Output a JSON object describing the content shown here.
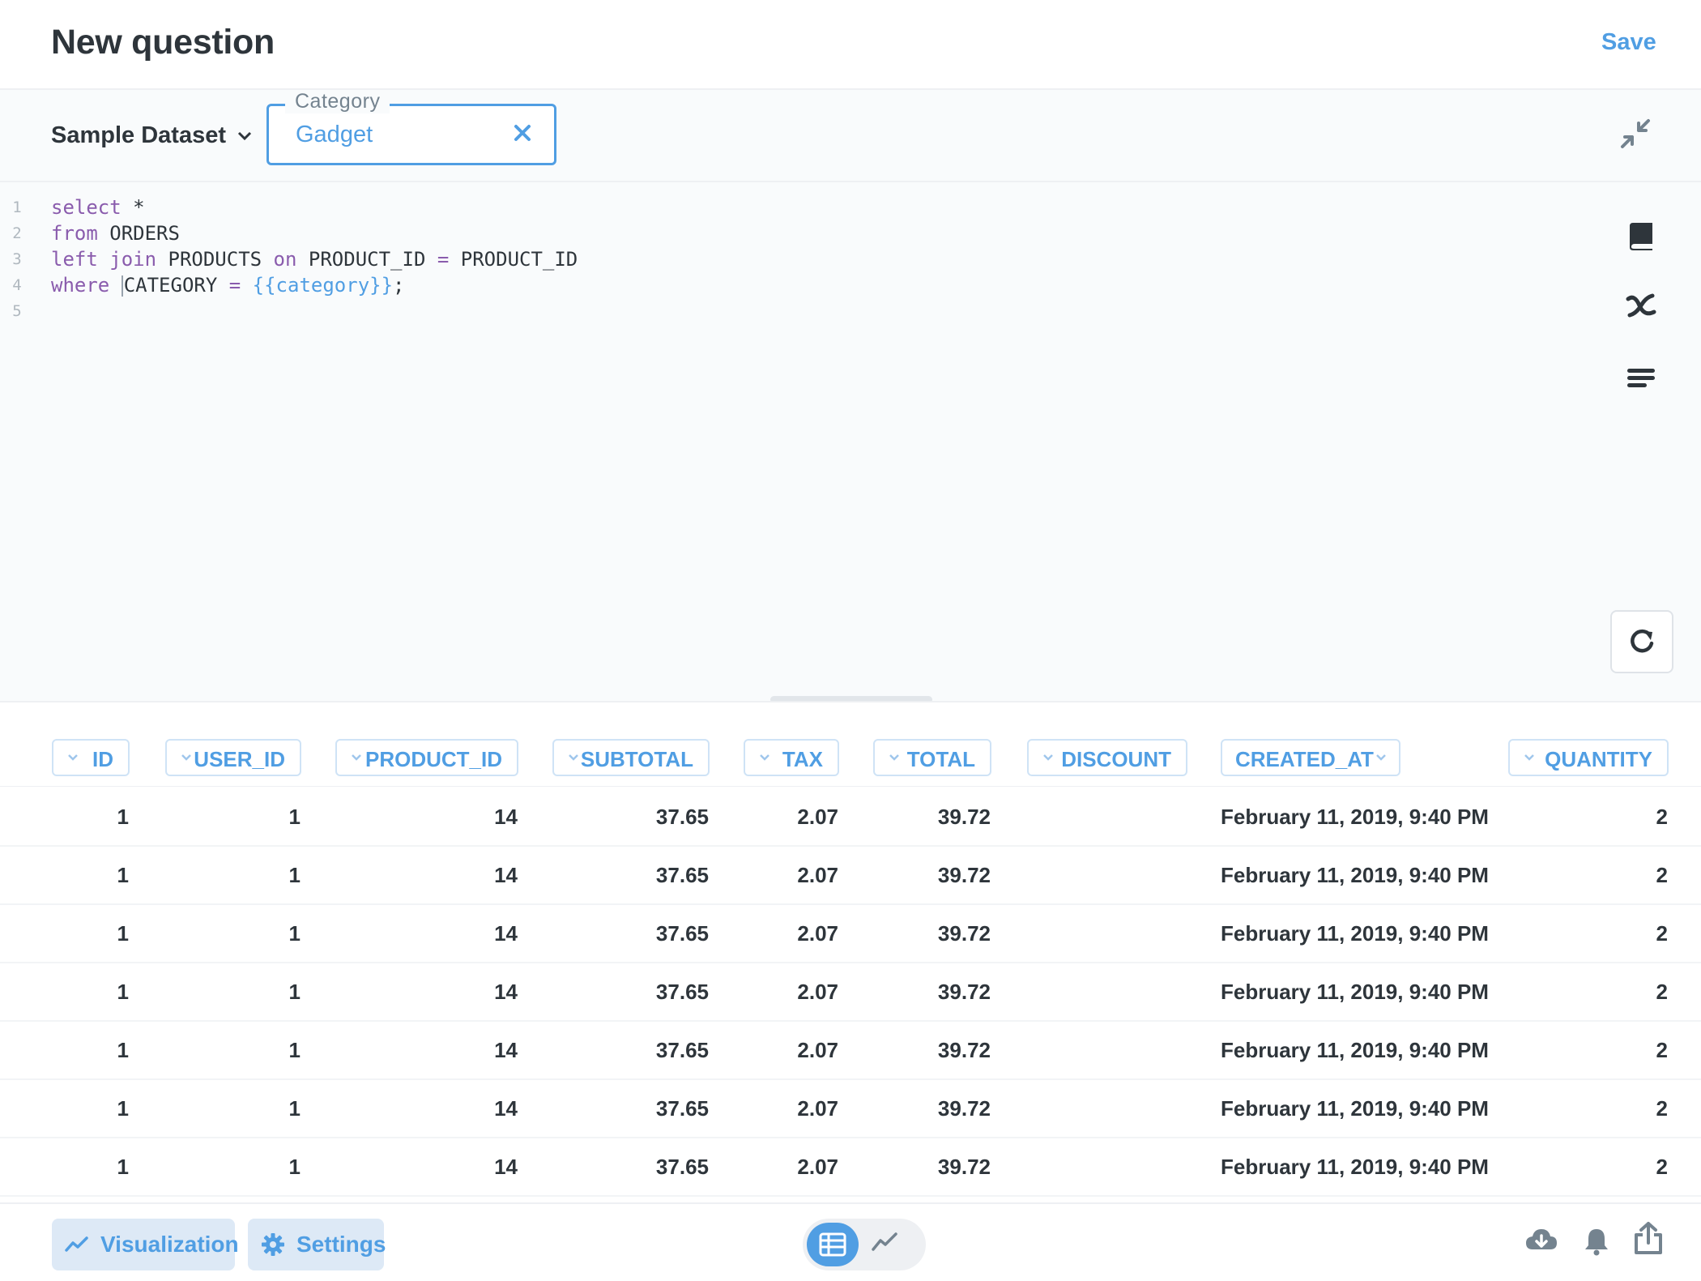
{
  "header": {
    "title": "New question",
    "save_label": "Save"
  },
  "filter_bar": {
    "database": "Sample Dataset",
    "parameter": {
      "label": "Category",
      "value": "Gadget"
    }
  },
  "editor": {
    "lines": [
      {
        "number": "1"
      },
      {
        "number": "2"
      },
      {
        "number": "3"
      },
      {
        "number": "4"
      },
      {
        "number": "5"
      }
    ],
    "tokens": {
      "select": "select",
      "star": "*",
      "from": "from",
      "orders": "ORDERS",
      "left": "left",
      "join": "join",
      "products": "PRODUCTS",
      "on": "on",
      "product_id_a": "PRODUCT_ID",
      "eq": "=",
      "product_id_b": "PRODUCT_ID",
      "where": "where",
      "category": "CATEGORY",
      "eq2": "=",
      "tag": "{{category}}",
      "semi": ";"
    }
  },
  "table": {
    "columns": [
      "ID",
      "USER_ID",
      "PRODUCT_ID",
      "SUBTOTAL",
      "TAX",
      "TOTAL",
      "DISCOUNT",
      "CREATED_AT",
      "QUANTITY"
    ],
    "rows": [
      [
        "1",
        "1",
        "14",
        "37.65",
        "2.07",
        "39.72",
        "",
        "February 11, 2019, 9:40 PM",
        "2"
      ],
      [
        "1",
        "1",
        "14",
        "37.65",
        "2.07",
        "39.72",
        "",
        "February 11, 2019, 9:40 PM",
        "2"
      ],
      [
        "1",
        "1",
        "14",
        "37.65",
        "2.07",
        "39.72",
        "",
        "February 11, 2019, 9:40 PM",
        "2"
      ],
      [
        "1",
        "1",
        "14",
        "37.65",
        "2.07",
        "39.72",
        "",
        "February 11, 2019, 9:40 PM",
        "2"
      ],
      [
        "1",
        "1",
        "14",
        "37.65",
        "2.07",
        "39.72",
        "",
        "February 11, 2019, 9:40 PM",
        "2"
      ],
      [
        "1",
        "1",
        "14",
        "37.65",
        "2.07",
        "39.72",
        "",
        "February 11, 2019, 9:40 PM",
        "2"
      ],
      [
        "1",
        "1",
        "14",
        "37.65",
        "2.07",
        "39.72",
        "",
        "February 11, 2019, 9:40 PM",
        "2"
      ]
    ]
  },
  "footer": {
    "visualization_label": "Visualization",
    "settings_label": "Settings"
  },
  "colors": {
    "brand": "#509ee3",
    "text": "#2e353b",
    "keyword": "#8a5cad",
    "editor_bg": "#f9fbfc"
  },
  "icons": [
    "chevron-down-icon",
    "close-icon",
    "contract-icon",
    "book-icon",
    "variable-icon",
    "snippet-icon",
    "refresh-icon",
    "line-chart-icon",
    "gear-icon",
    "table-icon",
    "download-icon",
    "bell-icon",
    "share-icon"
  ]
}
